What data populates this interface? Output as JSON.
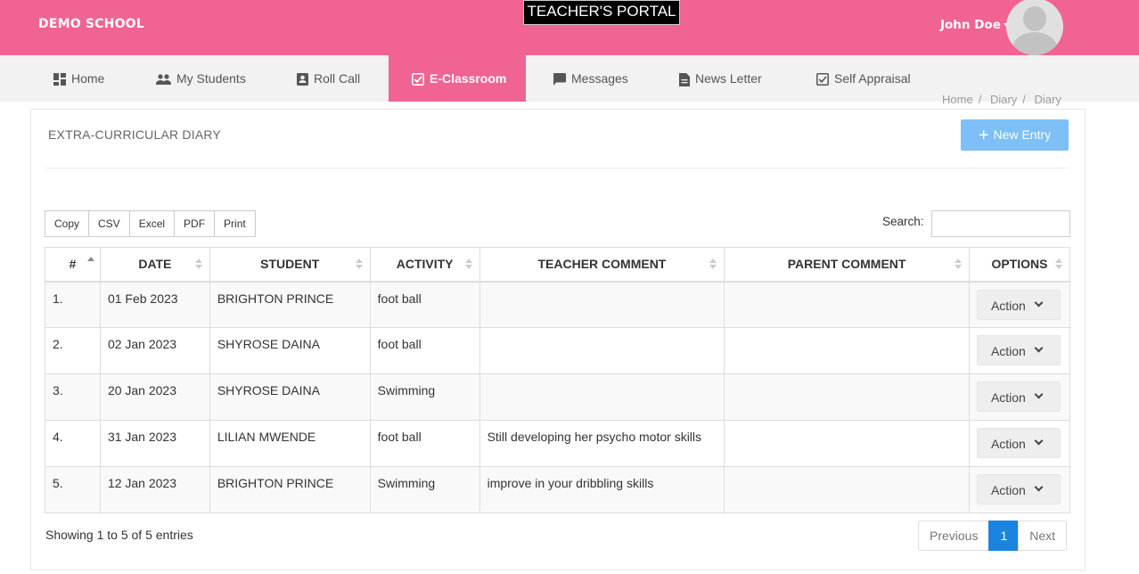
{
  "header": {
    "school_name": "DEMO SCHOOL",
    "portal_title": "TEACHER'S PORTAL",
    "user_name": "John Doe"
  },
  "nav": [
    {
      "label": "Home",
      "icon": "dashboard-icon",
      "active": false
    },
    {
      "label": "My Students",
      "icon": "people-icon",
      "active": false
    },
    {
      "label": "Roll Call",
      "icon": "contact-card-icon",
      "active": false
    },
    {
      "label": "E-Classroom",
      "icon": "checkbox-icon",
      "active": true
    },
    {
      "label": "Messages",
      "icon": "message-icon",
      "active": false
    },
    {
      "label": "News Letter",
      "icon": "document-icon",
      "active": false
    },
    {
      "label": "Self Appraisal",
      "icon": "checkbox-outline-icon",
      "active": false
    }
  ],
  "breadcrumb": [
    "Home",
    "Diary",
    "Diary"
  ],
  "panel": {
    "title": "EXTRA-CURRICULAR DIARY",
    "new_entry_label": "New Entry"
  },
  "exports": [
    "Copy",
    "CSV",
    "Excel",
    "PDF",
    "Print"
  ],
  "search": {
    "label": "Search:",
    "value": ""
  },
  "table": {
    "columns": [
      "#",
      "DATE",
      "STUDENT",
      "ACTIVITY",
      "TEACHER COMMENT",
      "PARENT COMMENT",
      "OPTIONS"
    ],
    "rows": [
      {
        "num": "1.",
        "date": "01 Feb 2023",
        "student": "BRIGHTON PRINCE",
        "activity": "foot ball",
        "teacher_comment": "",
        "parent_comment": "",
        "action": "Action"
      },
      {
        "num": "2.",
        "date": "02 Jan 2023",
        "student": "SHYROSE DAINA",
        "activity": "foot ball",
        "teacher_comment": "",
        "parent_comment": "",
        "action": "Action"
      },
      {
        "num": "3.",
        "date": "20 Jan 2023",
        "student": "SHYROSE DAINA",
        "activity": "Swimming",
        "teacher_comment": "",
        "parent_comment": "",
        "action": "Action"
      },
      {
        "num": "4.",
        "date": "31 Jan 2023",
        "student": "LILIAN MWENDE",
        "activity": "foot ball",
        "teacher_comment": "Still developing her psycho motor skills",
        "parent_comment": "",
        "action": "Action"
      },
      {
        "num": "5.",
        "date": "12 Jan 2023",
        "student": "BRIGHTON PRINCE",
        "activity": "Swimming",
        "teacher_comment": "improve in your dribbling skills",
        "parent_comment": "",
        "action": "Action"
      }
    ]
  },
  "info": "Showing 1 to 5 of 5 entries",
  "pagination": {
    "previous": "Previous",
    "current": "1",
    "next": "Next"
  },
  "colors": {
    "brand_pink": "#f06393",
    "button_blue": "#7dbff6",
    "page_active": "#1a84e0"
  }
}
